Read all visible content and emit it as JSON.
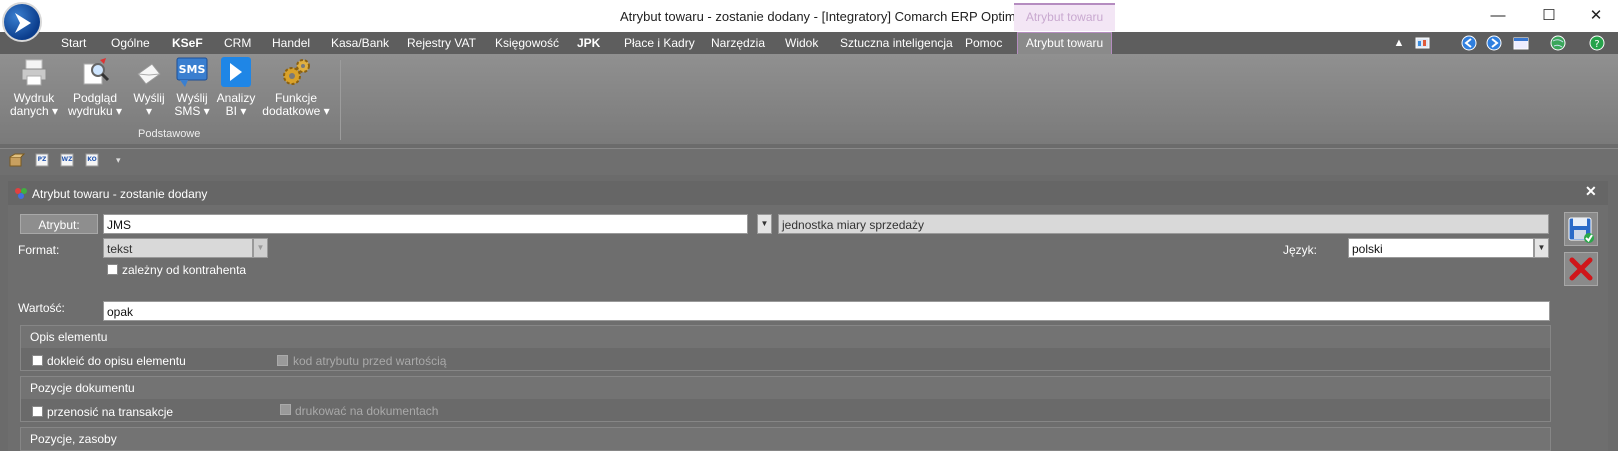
{
  "window": {
    "title": "Atrybut towaru - zostanie dodany - [Integratory] Comarch ERP Optima",
    "context_tab": "Atrybut towaru",
    "minimize": "—",
    "maximize": "☐",
    "close": "✕"
  },
  "menu": {
    "tabs": [
      "Start",
      "Ogólne",
      "KSeF",
      "CRM",
      "Handel",
      "Kasa/Bank",
      "Rejestry VAT",
      "Księgowość",
      "JPK",
      "Płace i Kadry",
      "Narzędzia",
      "Widok",
      "Sztuczna inteligencja",
      "Pomoc",
      "Atrybut towaru"
    ],
    "right_icons": [
      "chevron-up",
      "report",
      "back",
      "forward",
      "window",
      "globe",
      "help"
    ]
  },
  "ribbon": {
    "buttons": [
      {
        "line1": "Wydruk",
        "line2": "danych ▾",
        "icon": "printer"
      },
      {
        "line1": "Podgląd",
        "line2": "wydruku ▾",
        "icon": "preview"
      },
      {
        "line1": "Wyślij",
        "line2": "▾",
        "icon": "send"
      },
      {
        "line1": "Wyślij",
        "line2": "SMS ▾",
        "icon": "sms"
      },
      {
        "line1": "Analizy",
        "line2": "BI ▾",
        "icon": "analytics"
      },
      {
        "line1": "Funkcje",
        "line2": "dodatkowe ▾",
        "icon": "gears"
      }
    ],
    "group_label": "Podstawowe",
    "sms_text": "SMS"
  },
  "quick_toolbar": {
    "icons": [
      "box",
      "pz",
      "wz",
      "ko",
      "dropdown"
    ],
    "texts": [
      "PZ",
      "WZ",
      "KO"
    ]
  },
  "form": {
    "title": "Atrybut towaru - zostanie dodany",
    "attr_button": "Atrybut:",
    "attr_value": "JMS",
    "attr_description": "jednostka miary sprzedaży",
    "format_label": "Format:",
    "format_value": "tekst",
    "language_label": "Język:",
    "language_value": "polski",
    "dependent_label": "zależny od kontrahenta",
    "value_label": "Wartość:",
    "value": "opak",
    "sections": [
      {
        "title": "Opis elementu",
        "cb1": "dokleić do opisu elementu",
        "cb2": "kod atrybutu przed wartością"
      },
      {
        "title": "Pozycje dokumentu",
        "cb1": "przenosić na transakcje",
        "cb2": "drukować na dokumentach"
      },
      {
        "title": "Pozycje, zasoby"
      }
    ]
  },
  "colors": {
    "accent_tab_border": "#b58cc0",
    "save_icon": "#2a6ac8",
    "cancel_icon": "#d0161a"
  }
}
